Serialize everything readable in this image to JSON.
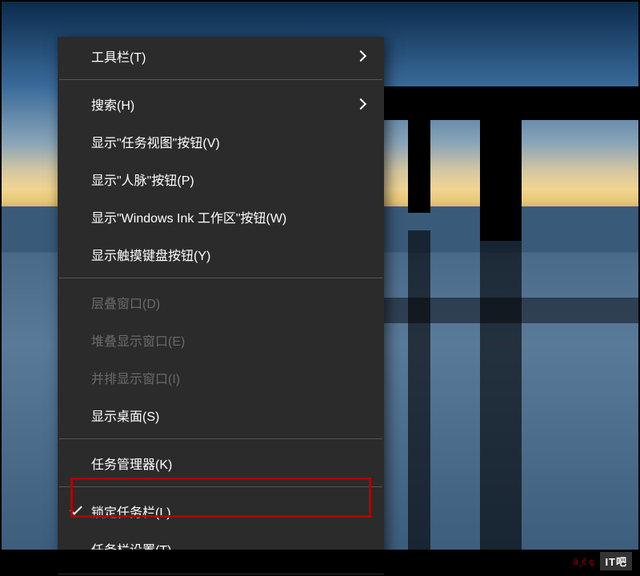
{
  "menu": {
    "items": [
      {
        "id": "toolbars",
        "label": "工具栏(T)",
        "submenu": true
      },
      {
        "id": "search",
        "label": "搜索(H)",
        "submenu": true
      },
      {
        "id": "task-view",
        "label": "显示\"任务视图\"按钮(V)"
      },
      {
        "id": "people",
        "label": "显示\"人脉\"按钮(P)"
      },
      {
        "id": "ink",
        "label": "显示\"Windows Ink 工作区\"按钮(W)"
      },
      {
        "id": "touch-keyboard",
        "label": "显示触摸键盘按钮(Y)"
      },
      {
        "id": "cascade",
        "label": "层叠窗口(D)",
        "disabled": true
      },
      {
        "id": "stacked",
        "label": "堆叠显示窗口(E)",
        "disabled": true
      },
      {
        "id": "side-by-side",
        "label": "并排显示窗口(I)",
        "disabled": true
      },
      {
        "id": "show-desktop",
        "label": "显示桌面(S)"
      },
      {
        "id": "task-manager",
        "label": "任务管理器(K)"
      },
      {
        "id": "lock-taskbar",
        "label": "锁定任务栏(L)",
        "checked": true
      },
      {
        "id": "taskbar-settings",
        "label": "任务栏设置(T)"
      }
    ]
  },
  "watermark": {
    "text": "ä¸č ç",
    "logo": "IT吧"
  }
}
